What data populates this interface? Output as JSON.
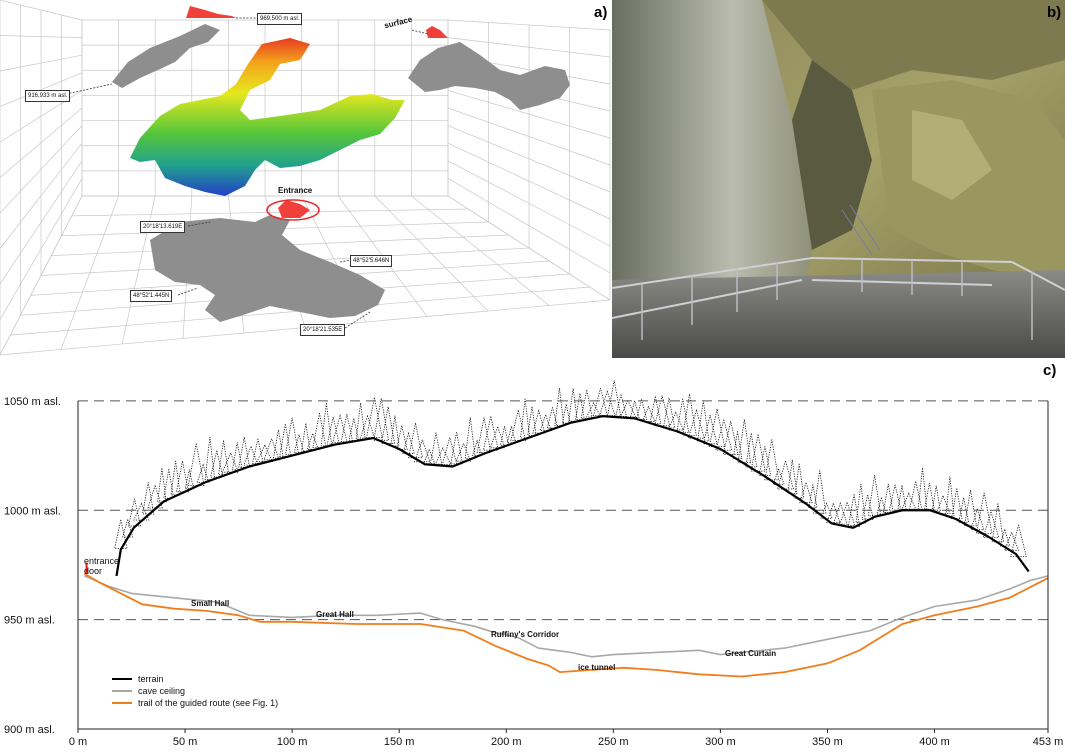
{
  "panels": {
    "a": {
      "label": "a)",
      "elevation_top": "969,500 m asl.",
      "elevation_left": "916,933 m asl.",
      "surface": "surface",
      "entrance": "Entrance",
      "coord_w": "20°18'13.619E",
      "coord_n_right": "48°52'5.646N",
      "coord_n_left": "48°52'1.445N",
      "coord_e": "20°18'21.535E",
      "colors": {
        "grid": "#c8c8c8",
        "projection": "#8a8a8a",
        "highlight": "#f0403a"
      }
    },
    "b": {
      "label": "b)"
    },
    "c": {
      "label": "c)",
      "annotation_entrance": [
        "entrance",
        "door"
      ],
      "places": [
        "Small Hall",
        "Great Hall",
        "Ruffiny's Corridor",
        "ice tunnel",
        "Great Curtain"
      ]
    }
  },
  "chart_data": {
    "type": "line",
    "title": "",
    "xlabel": "",
    "ylabel": "",
    "xlim": [
      0,
      453
    ],
    "ylim": [
      900,
      1060
    ],
    "x_ticks": [
      "0 m",
      "50 m",
      "100 m",
      "150 m",
      "200 m",
      "250 m",
      "300 m",
      "350 m",
      "400 m",
      "453 m"
    ],
    "y_ticks": [
      {
        "value": 1050,
        "label": "1050 m asl."
      },
      {
        "value": 1000,
        "label": "1000 m asl."
      },
      {
        "value": 950,
        "label": "950 m asl."
      },
      {
        "value": 900,
        "label": "900 m asl."
      }
    ],
    "grid": "dashed-horizontal",
    "legend_position": "bottom-left",
    "series": [
      {
        "name": "terrain",
        "color": "#000000",
        "points": [
          [
            18,
            970
          ],
          [
            20,
            982
          ],
          [
            26,
            992
          ],
          [
            40,
            1004
          ],
          [
            60,
            1013
          ],
          [
            80,
            1020
          ],
          [
            100,
            1025
          ],
          [
            120,
            1030
          ],
          [
            138,
            1033
          ],
          [
            150,
            1028
          ],
          [
            162,
            1021
          ],
          [
            175,
            1020
          ],
          [
            190,
            1026
          ],
          [
            210,
            1033
          ],
          [
            230,
            1040
          ],
          [
            245,
            1043
          ],
          [
            260,
            1042
          ],
          [
            280,
            1036
          ],
          [
            300,
            1028
          ],
          [
            320,
            1016
          ],
          [
            340,
            1003
          ],
          [
            352,
            994
          ],
          [
            362,
            992
          ],
          [
            372,
            997
          ],
          [
            385,
            1000
          ],
          [
            398,
            1000
          ],
          [
            410,
            996
          ],
          [
            425,
            988
          ],
          [
            438,
            980
          ],
          [
            444,
            972
          ]
        ]
      },
      {
        "name": "cave ceiling",
        "color": "#a8a8a8",
        "points": [
          [
            3,
            970
          ],
          [
            15,
            965
          ],
          [
            25,
            962
          ],
          [
            45,
            960
          ],
          [
            65,
            958
          ],
          [
            80,
            952
          ],
          [
            100,
            951
          ],
          [
            120,
            952
          ],
          [
            140,
            952
          ],
          [
            160,
            953
          ],
          [
            170,
            950
          ],
          [
            185,
            947
          ],
          [
            195,
            944
          ],
          [
            205,
            942
          ],
          [
            215,
            937
          ],
          [
            230,
            935
          ],
          [
            240,
            933
          ],
          [
            250,
            934
          ],
          [
            270,
            935
          ],
          [
            290,
            936
          ],
          [
            300,
            934
          ],
          [
            310,
            935
          ],
          [
            330,
            937
          ],
          [
            350,
            941
          ],
          [
            370,
            945
          ],
          [
            385,
            951
          ],
          [
            400,
            956
          ],
          [
            420,
            959
          ],
          [
            435,
            964
          ],
          [
            445,
            968
          ],
          [
            453,
            970
          ]
        ]
      },
      {
        "name": "trail of the guided route  (see Fig. 1)",
        "color": "#f07e1c",
        "points": [
          [
            3,
            971
          ],
          [
            10,
            967
          ],
          [
            20,
            962
          ],
          [
            30,
            957
          ],
          [
            45,
            955
          ],
          [
            60,
            954
          ],
          [
            75,
            952
          ],
          [
            85,
            949
          ],
          [
            100,
            949
          ],
          [
            130,
            948
          ],
          [
            160,
            948
          ],
          [
            180,
            945
          ],
          [
            195,
            938
          ],
          [
            210,
            932
          ],
          [
            220,
            929
          ],
          [
            225,
            926
          ],
          [
            240,
            927
          ],
          [
            255,
            928
          ],
          [
            270,
            927
          ],
          [
            290,
            925
          ],
          [
            310,
            924
          ],
          [
            330,
            926
          ],
          [
            350,
            930
          ],
          [
            365,
            936
          ],
          [
            375,
            942
          ],
          [
            385,
            948
          ],
          [
            400,
            952
          ],
          [
            420,
            956
          ],
          [
            435,
            960
          ],
          [
            445,
            965
          ],
          [
            453,
            969
          ]
        ]
      }
    ]
  }
}
